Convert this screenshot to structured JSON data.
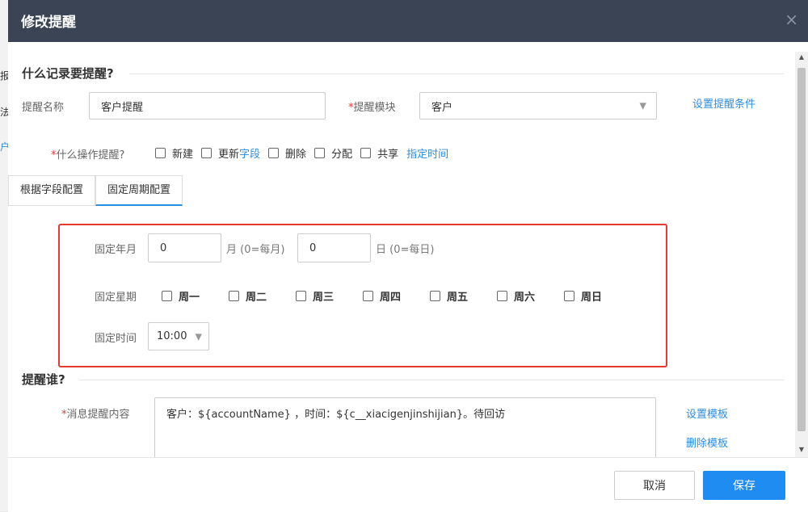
{
  "background_fragments": [
    "报",
    "法",
    "户"
  ],
  "dialog": {
    "title": "修改提醒",
    "close_symbol": "×"
  },
  "section1": {
    "title": "什么记录要提醒?",
    "name_label": "提醒名称",
    "name_value": "客户提醒",
    "module_label": "提醒模块",
    "module_value": "客户",
    "set_conditions_link": "设置提醒条件",
    "operation_label": "什么操作提醒?",
    "operations": [
      {
        "label": "新建",
        "checked": false
      },
      {
        "label": "更新",
        "link": "字段",
        "checked": false
      },
      {
        "label": "删除",
        "checked": false
      },
      {
        "label": "分配",
        "checked": false
      },
      {
        "label": "共享",
        "checked": false
      }
    ],
    "specified_time_link": "指定时间"
  },
  "tabs": [
    {
      "label": "根据字段配置",
      "active": false
    },
    {
      "label": "固定周期配置",
      "active": true
    }
  ],
  "fixed": {
    "year_month_label": "固定年月",
    "month_value": "0",
    "month_hint": "月 (0=每月)",
    "day_value": "0",
    "day_hint": "日 (0=每日)",
    "weekday_label": "固定星期",
    "weekdays": [
      "周一",
      "周二",
      "周三",
      "周四",
      "周五",
      "周六",
      "周日"
    ],
    "time_label": "固定时间",
    "time_value": "10:00"
  },
  "section2": {
    "title": "提醒谁?",
    "content_label": "消息提醒内容",
    "content_value": "客户：${accountName} ，时间：${c__xiacigenjinshijian}。待回访",
    "set_template_link": "设置模板",
    "delete_template_link": "删除模板"
  },
  "footer": {
    "cancel_label": "取消",
    "save_label": "保存"
  },
  "colors": {
    "titlebar": "#3a4454",
    "primary": "#1e8cf0",
    "link": "#2d8ee0",
    "highlight_border": "#e53935",
    "required": "#e4393c"
  },
  "icons": {
    "close": "close-icon",
    "dropdown": "chevron-down-icon"
  }
}
